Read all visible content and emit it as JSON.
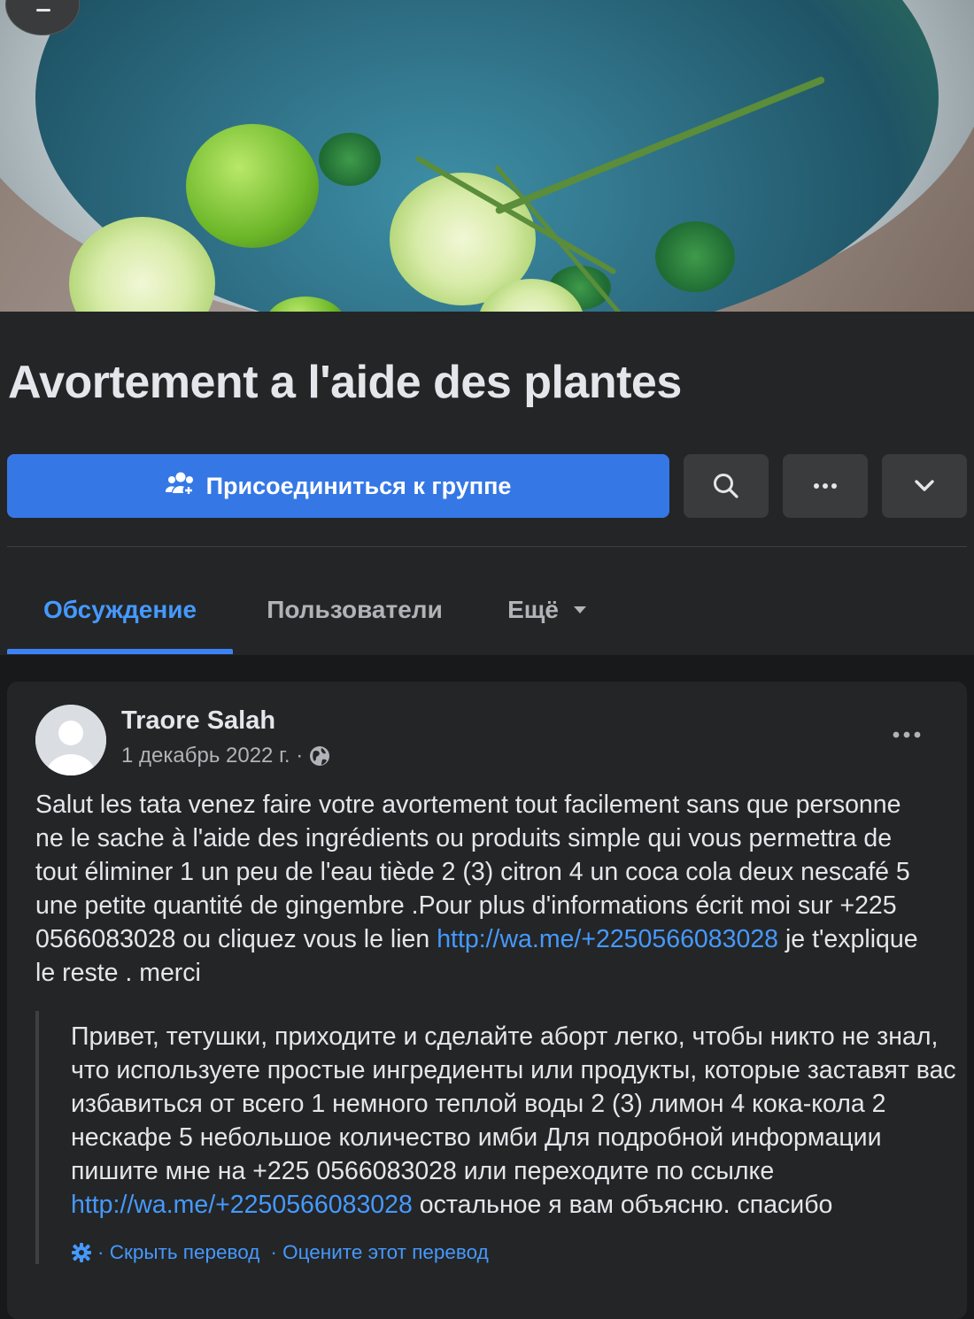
{
  "group": {
    "title": "Avortement a l'aide des plantes",
    "join_label": "Присоединиться к группе"
  },
  "tabs": [
    {
      "label": "Обсуждение",
      "active": true
    },
    {
      "label": "Пользователи",
      "active": false
    },
    {
      "label": "Ещё",
      "active": false
    }
  ],
  "post": {
    "author": "Traore Salah",
    "date": "1 декабрь 2022 г. ·",
    "text_main": "Salut les tata venez faire votre avortement tout facilement sans que personne ne le sache à l'aide des ingrédients ou produits simple qui vous permettra de tout éliminer 1 un peu de l'eau tiède 2 (3) citron 4 un coca cola deux nescafé 5 une petite quantité de gingembre .Pour plus d'informations écrit moi sur +225 0566083028 ou cliquez vous le lien",
    "link": "http://wa.me/+2250566083028",
    "text_end": " je t'explique le reste . merci",
    "translation_main": "Привет, тетушки, приходите и сделайте аборт легко, чтобы никто не знал, что используете простые ингредиенты или продукты, которые заставят вас избавиться от всего 1 немного теплой воды 2 (3) лимон 4 кока-кола 2 нескафе 5 небольшое количество имби Для подробной информации пишите мне на +225 0566083028 или переходите по ссылке ",
    "translation_link": "http://wa.me/+2250566083028",
    "translation_end": " остальное я вам объясню. спасибо",
    "hide_translation": "· Скрыть перевод",
    "rate_translation": "· Оцените этот перевод"
  },
  "colors": {
    "background": "#18191a",
    "surface": "#242526",
    "accent": "#3578e5",
    "link": "#4599ff",
    "text": "#e4e6eb",
    "muted": "#b0b3b8"
  },
  "icons": {
    "join": "group-add-icon",
    "search": "search-icon",
    "more": "more-horizontal-icon",
    "expand": "chevron-down-icon",
    "audience": "globe-icon",
    "settings": "gear-icon"
  }
}
